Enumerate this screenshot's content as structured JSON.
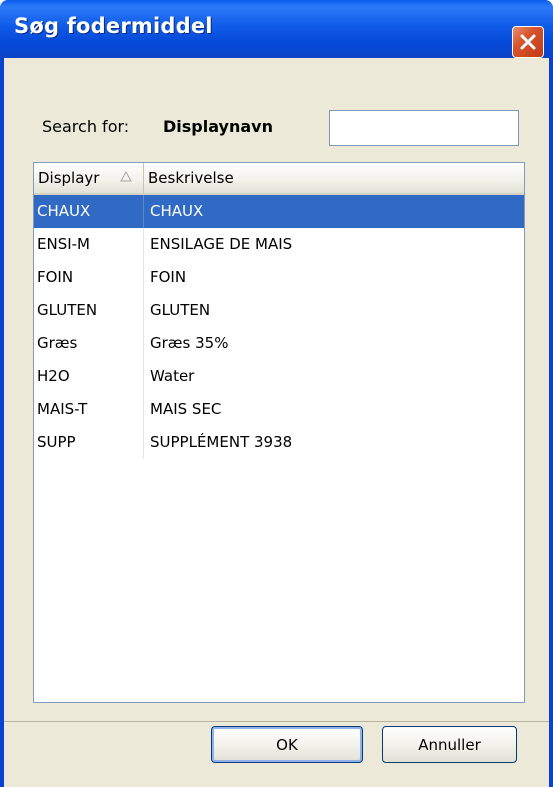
{
  "window": {
    "title": "Søg fodermiddel",
    "close_icon": "close-x-icon"
  },
  "search": {
    "label": "Search for:",
    "field_name": "Displaynavn",
    "value": "",
    "placeholder": ""
  },
  "table": {
    "columns": [
      "Displayr",
      "Beskrivelse"
    ],
    "sort_icon": "sort-ascending-icon",
    "selected_index": 0,
    "rows": [
      {
        "display": "CHAUX",
        "description": "CHAUX"
      },
      {
        "display": "ENSI-M",
        "description": "ENSILAGE DE MAIS"
      },
      {
        "display": "FOIN",
        "description": "FOIN"
      },
      {
        "display": "GLUTEN",
        "description": "GLUTEN"
      },
      {
        "display": "Græs",
        "description": "Græs 35%"
      },
      {
        "display": "H2O",
        "description": "Water"
      },
      {
        "display": "MAIS-T",
        "description": "MAIS SEC"
      },
      {
        "display": "SUPP",
        "description": "SUPPLÉMENT 3938"
      }
    ]
  },
  "buttons": {
    "ok_label": "OK",
    "cancel_label": "Annuller"
  },
  "colors": {
    "titlebar": "#0a5cf0",
    "selection": "#316ac5",
    "dialog_bg": "#ece9d8"
  }
}
